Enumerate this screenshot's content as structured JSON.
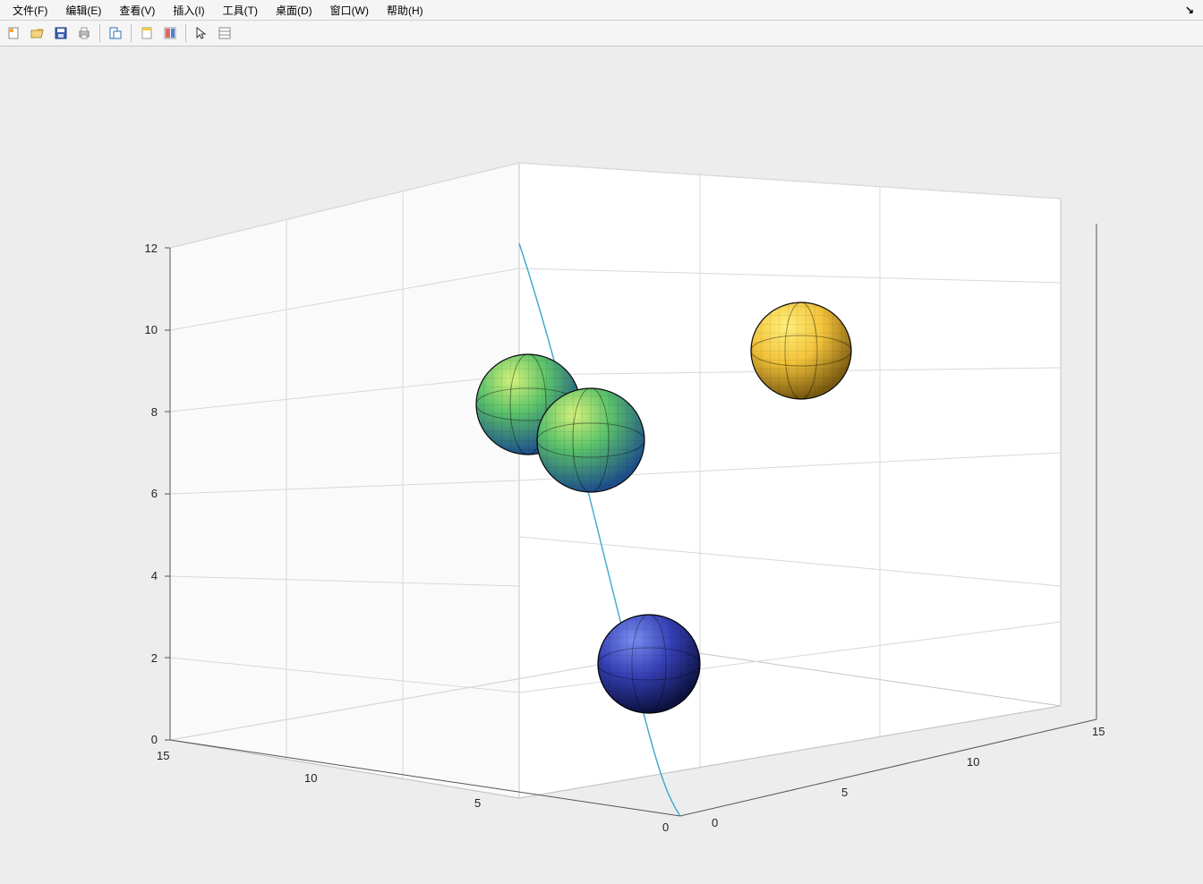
{
  "menu": {
    "items": [
      "文件(F)",
      "编辑(E)",
      "查看(V)",
      "插入(I)",
      "工具(T)",
      "桌面(D)",
      "窗口(W)",
      "帮助(H)"
    ]
  },
  "toolbar": {
    "icons": [
      "new-figure-icon",
      "open-icon",
      "save-icon",
      "print-icon",
      "sep",
      "print-preview-icon",
      "sep",
      "link-icon",
      "insert-colorbar-icon",
      "sep",
      "pointer-icon",
      "data-cursor-icon"
    ]
  },
  "chart_data": {
    "type": "3d-scatter-line",
    "x_ticks": [
      0,
      5,
      10,
      15
    ],
    "y_ticks": [
      0,
      5,
      10,
      15
    ],
    "z_ticks": [
      0,
      2,
      4,
      6,
      8,
      10,
      12
    ],
    "xlim": [
      0,
      15
    ],
    "ylim": [
      0,
      15
    ],
    "zlim": [
      0,
      12
    ],
    "spheres": [
      {
        "x": 5,
        "y": 4,
        "z": 8.5,
        "r": 1,
        "color": "green"
      },
      {
        "x": 6,
        "y": 5,
        "z": 8,
        "r": 1,
        "color": "green"
      },
      {
        "x": 7,
        "y": 12,
        "z": 9.5,
        "r": 1,
        "color": "yellow"
      },
      {
        "x": 7,
        "y": 7,
        "z": 2,
        "r": 1,
        "color": "blue"
      }
    ],
    "curve": {
      "from": [
        3,
        0,
        12
      ],
      "to": [
        8,
        0,
        0
      ]
    }
  },
  "ticklabels": {
    "z": [
      "0",
      "2",
      "4",
      "6",
      "8",
      "10",
      "12"
    ],
    "x": [
      "0",
      "5",
      "10",
      "15"
    ],
    "y": [
      "0",
      "5",
      "10",
      "15"
    ]
  },
  "menuCorner": "↘"
}
